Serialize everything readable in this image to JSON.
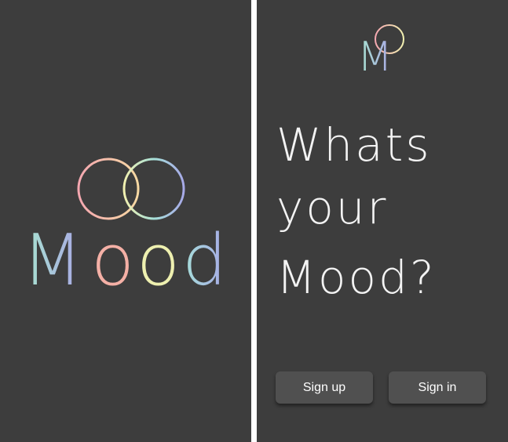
{
  "splash": {
    "brand_name": "Mood",
    "logo_letters": [
      "M",
      "o",
      "o",
      "d"
    ],
    "colors": {
      "background": "#3d3d3d",
      "mint": "#a8e6cf",
      "lavender": "#a9a6e6",
      "pink": "#f4a7b0",
      "peach": "#f7c6a3",
      "yellow": "#f1f0b0",
      "teal": "#a6e0d8",
      "periwinkle": "#a7a9e8"
    }
  },
  "welcome": {
    "logo_letter": "M",
    "headline_lines": [
      "Whats",
      "your",
      "Mood?"
    ],
    "buttons": {
      "signup_label": "Sign up",
      "signin_label": "Sign in"
    },
    "colors": {
      "background": "#3d3d3d",
      "button": "#505050",
      "text": "#f3f3f3"
    }
  }
}
